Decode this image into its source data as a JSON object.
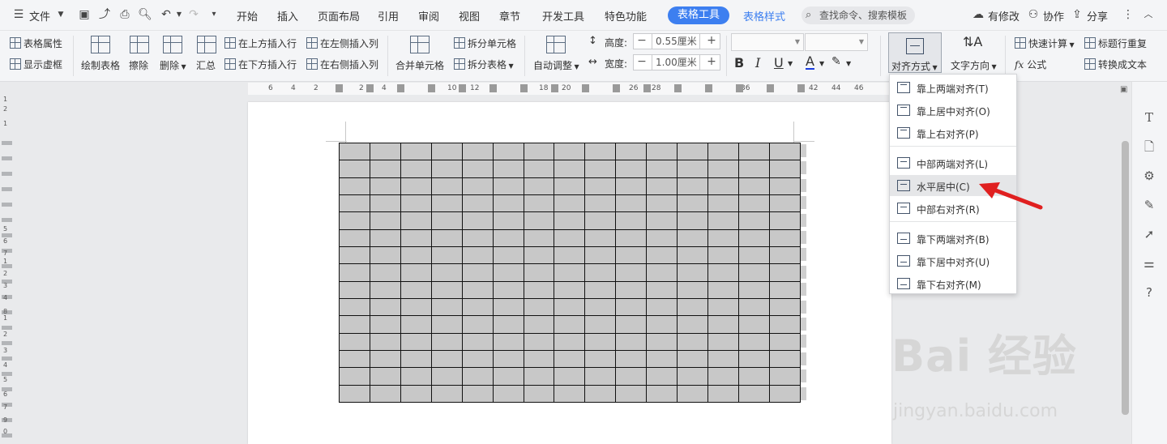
{
  "menubar": {
    "file": "文件",
    "tabs": [
      "开始",
      "插入",
      "页面布局",
      "引用",
      "审阅",
      "视图",
      "章节",
      "开发工具",
      "特色功能"
    ],
    "active_tab": "表格工具",
    "style_tab": "表格样式",
    "search_placeholder": "查找命令、搜索模板",
    "has_changes": "有修改",
    "collab": "协作",
    "share": "分享"
  },
  "ribbon": {
    "table_props": "表格属性",
    "show_gridlines": "显示虚框",
    "draw_table": "绘制表格",
    "erase": "擦除",
    "delete": "删除",
    "summary": "汇总",
    "insert_row_above": "在上方插入行",
    "insert_row_below": "在下方插入行",
    "insert_col_left": "在左侧插入列",
    "insert_col_right": "在右侧插入列",
    "merge_cells": "合并单元格",
    "split_cells": "拆分单元格",
    "split_table": "拆分表格",
    "autofit": "自动调整",
    "height_label": "高度:",
    "height_value": "0.55厘米",
    "width_label": "宽度:",
    "width_value": "1.00厘米",
    "align": "对齐方式",
    "text_dir": "文字方向",
    "quick_calc": "快速计算",
    "repeat_header": "标题行重复",
    "formula": "公式",
    "to_text": "转换成文本"
  },
  "ruler_ticks": [
    "6",
    "4",
    "2",
    "2",
    "4",
    "10",
    "12",
    "18",
    "20",
    "26",
    "28",
    "36",
    "42",
    "44",
    "46"
  ],
  "vruler_labels": [
    "1",
    "2",
    "1",
    "1",
    "2",
    "3",
    "4",
    "5",
    "6",
    "7",
    "8",
    "9",
    "0",
    "1",
    "2",
    "3",
    "4",
    "5",
    "6",
    "7"
  ],
  "alignment_menu": [
    {
      "label": "靠上两端对齐(T)",
      "pos": "t"
    },
    {
      "label": "靠上居中对齐(O)",
      "pos": "t"
    },
    {
      "label": "靠上右对齐(P)",
      "pos": "t"
    },
    {
      "label": "中部两端对齐(L)",
      "pos": "m"
    },
    {
      "label": "水平居中(C)",
      "pos": "m"
    },
    {
      "label": "中部右对齐(R)",
      "pos": "m"
    },
    {
      "label": "靠下两端对齐(B)",
      "pos": "b"
    },
    {
      "label": "靠下居中对齐(U)",
      "pos": "b"
    },
    {
      "label": "靠下右对齐(M)",
      "pos": "b"
    }
  ],
  "highlighted_menu_item": "水平居中(C)",
  "table": {
    "rows": 15,
    "cols": 15,
    "fill": "#c8c8c8"
  },
  "watermark": {
    "main": "Bai 经验",
    "sub": "jingyan.baidu.com"
  },
  "colors": {
    "accent": "#3d7ff0",
    "arrow": "#e02020"
  }
}
